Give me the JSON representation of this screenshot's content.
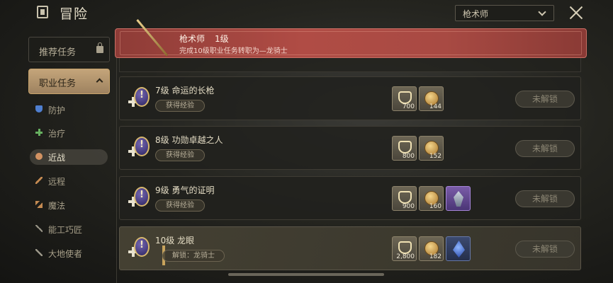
{
  "header": {
    "title": "冒险",
    "class_select": "枪术师"
  },
  "sidebar": {
    "recommended": "推荐任务",
    "job_quests": "职业任务",
    "items": [
      {
        "label": "防护",
        "icon": "shield-icon"
      },
      {
        "label": "治疗",
        "icon": "heal-cross-icon"
      },
      {
        "label": "近战",
        "icon": "melee-icon"
      },
      {
        "label": "远程",
        "icon": "ranged-icon"
      },
      {
        "label": "魔法",
        "icon": "magic-icon"
      },
      {
        "label": "能工巧匠",
        "icon": "crafter-icon"
      },
      {
        "label": "大地使者",
        "icon": "gatherer-icon"
      }
    ]
  },
  "banner": {
    "job": "枪术师",
    "level": "1级",
    "subtitle": "完成10级职业任务转职为—龙骑士"
  },
  "quests": [
    {
      "name": "7级 命运的长枪",
      "tag": "获得经验",
      "rewards": [
        "700",
        "144"
      ],
      "button": "未解锁"
    },
    {
      "name": "8级 功勋卓越之人",
      "tag": "获得经验",
      "rewards": [
        "800",
        "152"
      ],
      "button": "未解锁"
    },
    {
      "name": "9级 勇气的证明",
      "tag": "获得经验",
      "rewards": [
        "900",
        "160"
      ],
      "button": "未解锁"
    },
    {
      "name": "10级 龙眼",
      "tag": "解锁：龙骑士",
      "rewards": [
        "2,800",
        "182"
      ],
      "button": "未解锁"
    }
  ]
}
